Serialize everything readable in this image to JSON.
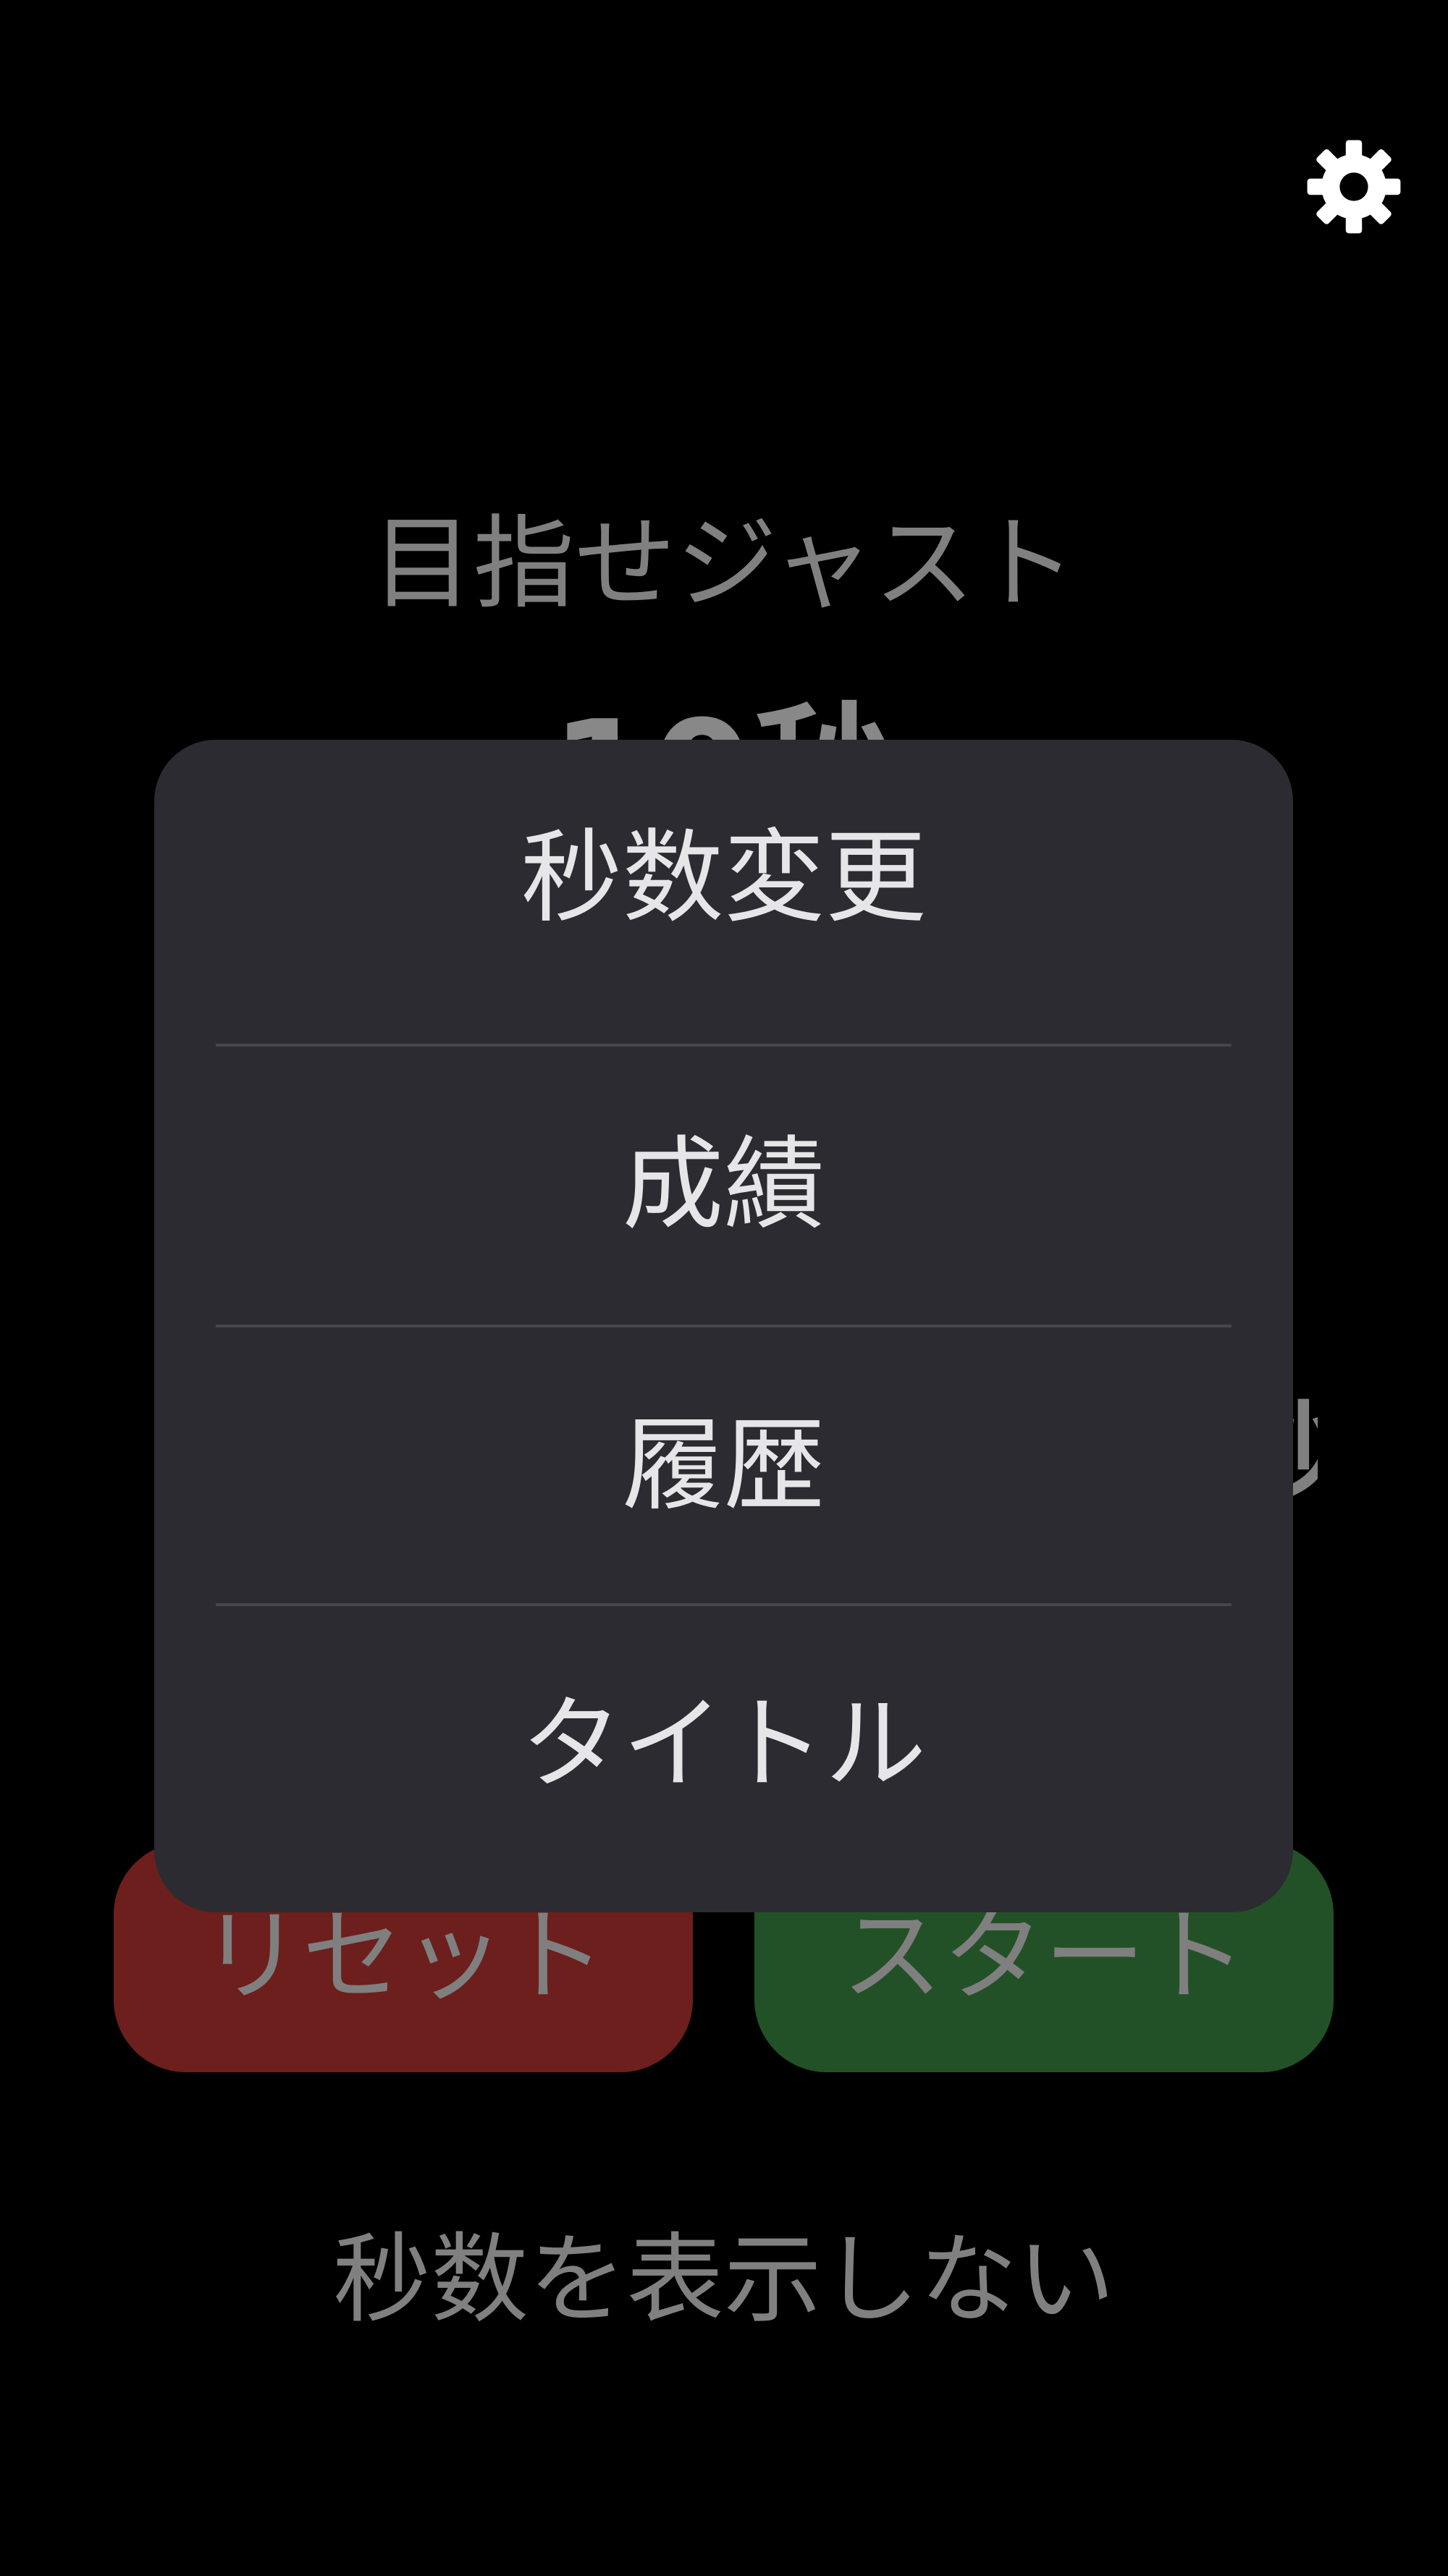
{
  "header": {
    "settings_icon": "gear-icon"
  },
  "game": {
    "title": "目指せジャスト",
    "target_seconds": "10秒",
    "timer_fragment": "秒",
    "reset_label": "リセット",
    "start_label": "スタート",
    "hide_seconds_label": "秒数を表示しない"
  },
  "menu": {
    "items": [
      {
        "label": "秒数変更"
      },
      {
        "label": "成績"
      },
      {
        "label": "履歴"
      },
      {
        "label": "タイトル"
      }
    ]
  },
  "colors": {
    "background": "#000000",
    "menu_background": "#2c2b31",
    "reset_button": "#6c1f1c",
    "start_button": "#235127",
    "menu_text": "#e6e6e8",
    "dimmed_text": "#808080"
  }
}
